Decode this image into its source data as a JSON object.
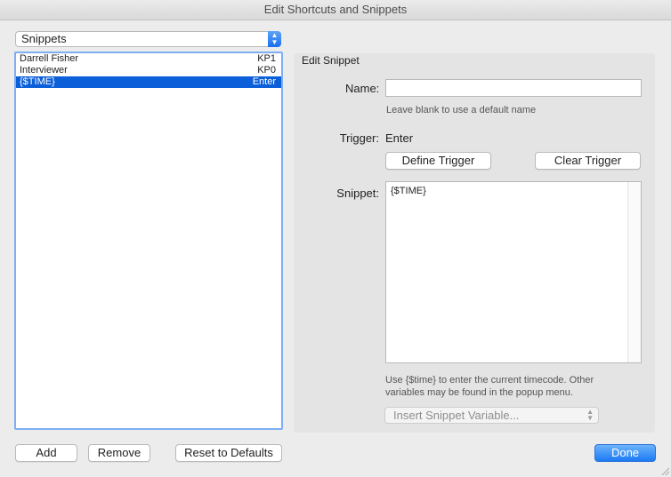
{
  "window": {
    "title": "Edit Shortcuts and Snippets"
  },
  "mode_select": {
    "value": "Snippets"
  },
  "list": {
    "items": [
      {
        "name": "Darrell Fisher",
        "shortcut": "KP1",
        "selected": false
      },
      {
        "name": "Interviewer",
        "shortcut": "KP0",
        "selected": false
      },
      {
        "name": "{$TIME}",
        "shortcut": "Enter",
        "selected": true
      }
    ]
  },
  "buttons": {
    "add": "Add",
    "remove": "Remove",
    "reset": "Reset to Defaults",
    "done": "Done"
  },
  "edit": {
    "heading": "Edit Snippet",
    "name_label": "Name:",
    "name_value": "",
    "name_help": "Leave blank to use a default name",
    "trigger_label": "Trigger:",
    "trigger_value": "Enter",
    "define_trigger": "Define Trigger",
    "clear_trigger": "Clear Trigger",
    "snippet_label": "Snippet:",
    "snippet_value": "{$TIME}",
    "snippet_help_line1": "Use {$time} to enter the current timecode. Other",
    "snippet_help_line2": "variables may be found in the popup menu.",
    "insert_variable": "Insert Snippet Variable..."
  },
  "colors": {
    "selection": "#0b5fd8",
    "accent": "#1b7bf5",
    "list_focus": "#7eaef5"
  }
}
